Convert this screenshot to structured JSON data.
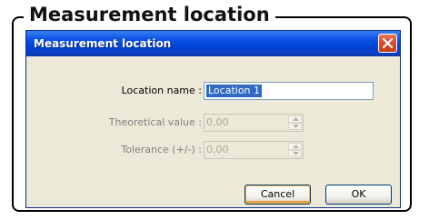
{
  "frame": {
    "heading": "Measurement location"
  },
  "dialog": {
    "title": "Measurement location",
    "close_icon": "close-icon",
    "fields": {
      "location_name": {
        "label": "Location name :",
        "value": "Location 1",
        "selected": true
      },
      "theoretical_value": {
        "label": "Theoretical value :",
        "value": "0,00",
        "enabled": false
      },
      "tolerance": {
        "label": "Tolerance (+/-) :",
        "value": "0,00",
        "enabled": false
      }
    },
    "buttons": {
      "cancel_label": "Cancel",
      "ok_label": "OK"
    }
  },
  "colors": {
    "titlebar": "#0046d5",
    "selection": "#316ac5",
    "dialog_bg": "#ece9d8",
    "close_button": "#d94f2a"
  }
}
